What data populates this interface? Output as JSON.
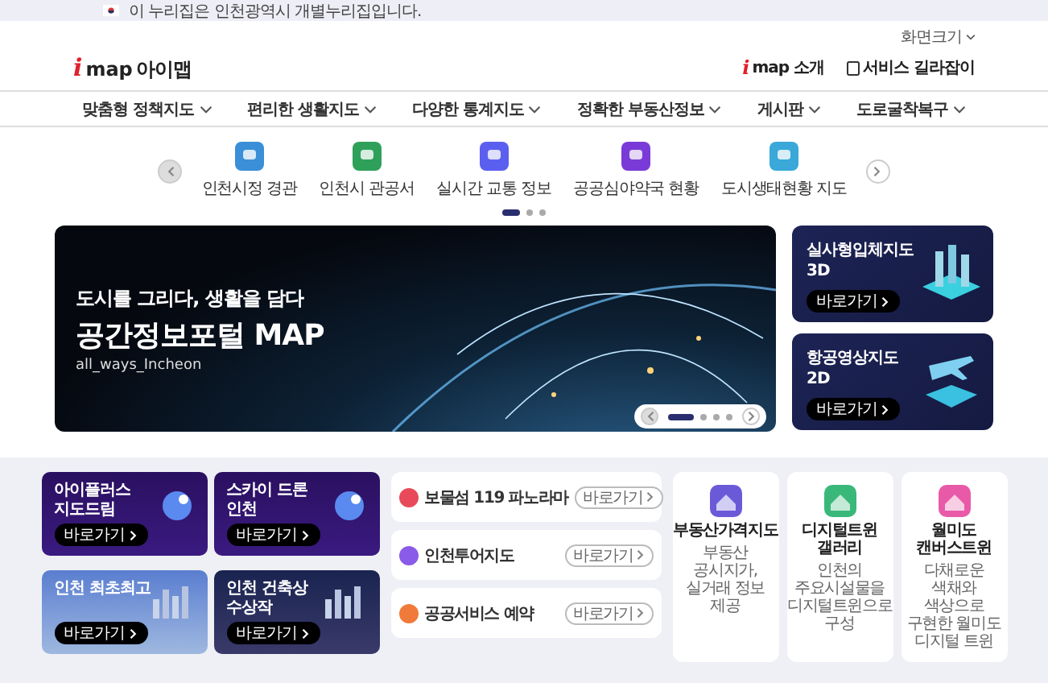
{
  "top_bar": {
    "text": "이 누리집은 인천광역시 개별누리집입니다."
  },
  "header": {
    "font_size_label": "화면크기",
    "logo": {
      "mark": "i",
      "text": "map",
      "name": "아이맵"
    },
    "links": [
      {
        "kind": "logo",
        "mark": "i",
        "text": "map 소개"
      },
      {
        "kind": "guide",
        "text": "서비스 길라잡이"
      }
    ]
  },
  "nav": [
    "맞춤형 정책지도",
    "편리한 생활지도",
    "다양한 통계지도",
    "정확한 부동산정보",
    "게시판",
    "도로굴착복구"
  ],
  "quick_menu": {
    "items": [
      {
        "label": "인천시정 경관",
        "color": "#3a8fd8"
      },
      {
        "label": "인천시 관공서",
        "color": "#2fa05a"
      },
      {
        "label": "실시간 교통 정보",
        "color": "#5b5ff0"
      },
      {
        "label": "공공심야약국 현황",
        "color": "#7a3ad8"
      },
      {
        "label": "도시생태현황 지도",
        "color": "#3aa8d8"
      }
    ],
    "pages": [
      {
        "selected": true
      },
      {
        "selected": false
      },
      {
        "selected": false
      }
    ]
  },
  "hero": {
    "kicker": "도시를 그리다, 생활을 담다",
    "title": "공간정보포털 MAP",
    "subtitle": "all_ways_Incheon",
    "slides": [
      {
        "selected": true
      },
      {
        "selected": false
      },
      {
        "selected": false
      },
      {
        "selected": false
      }
    ]
  },
  "side_cards": [
    {
      "kind": "city3d",
      "title": "실사형입체지도",
      "tag": "3D",
      "button": "바로가기"
    },
    {
      "kind": "plane",
      "title": "항공영상지도",
      "tag": "2D",
      "button": "바로가기"
    }
  ],
  "promos": [
    {
      "kind": "night",
      "title": "아이플러스 지도드림",
      "button": "바로가기"
    },
    {
      "kind": "night",
      "title": "스카이 드론 인천",
      "button": "바로가기"
    },
    {
      "kind": "sky",
      "title": "인천 최초최고",
      "button": "바로가기"
    },
    {
      "kind": "city",
      "title": "인천 건축상 수상작",
      "button": "바로가기"
    }
  ],
  "links": [
    {
      "title": "보물섬 119 파노라마",
      "button": "바로가기",
      "color": "#e84a5a"
    },
    {
      "title": "인천투어지도",
      "button": "바로가기",
      "color": "#8a5ae8"
    },
    {
      "title": "공공서비스 예약",
      "button": "바로가기",
      "color": "#f07a3a"
    }
  ],
  "tiles": [
    {
      "title": "부동산가격지도",
      "description": "부동산 공시지가, 실거래 정보 제공",
      "color": "#6a5ad8"
    },
    {
      "title": "디지털트윈 갤러리",
      "description": "인천의 주요시설물을 디지털트윈으로 구성",
      "color": "#3ab87a"
    },
    {
      "title": "월미도 캔버스트윈",
      "description": "다채로운 색채와 색상으로 구현한 월미도 디지털 트윈",
      "color": "#e85aa8"
    }
  ]
}
